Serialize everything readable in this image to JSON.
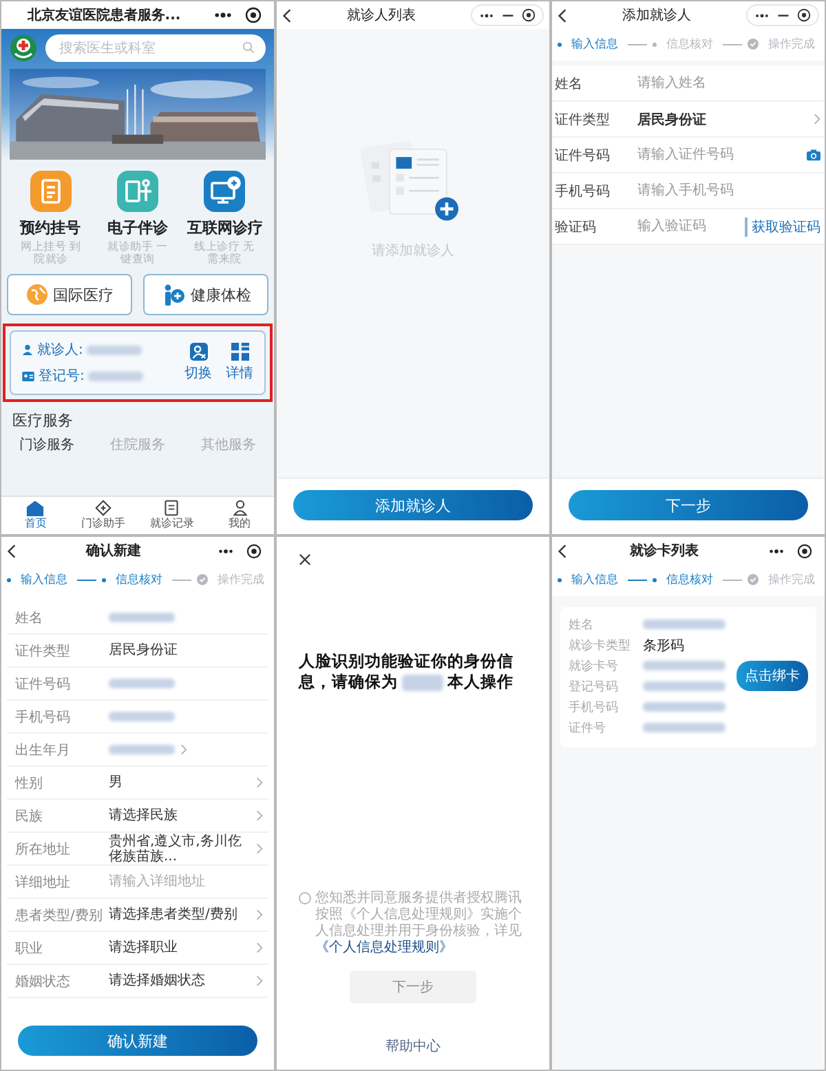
{
  "home": {
    "title": "北京友谊医院患者服务...",
    "search": {
      "placeholder": "搜索医生或科室"
    },
    "services": [
      {
        "kind": "register",
        "title": "预约挂号",
        "subtitle": "网上挂号 到院就诊",
        "color": "#f59a2c"
      },
      {
        "kind": "guide",
        "title": "电子伴诊",
        "subtitle": "就诊助手 一键查询",
        "color": "#3bb5b0"
      },
      {
        "kind": "online",
        "title": "互联网诊疗",
        "subtitle": "线上诊疗 无需来院",
        "color": "#1b7fc4"
      }
    ],
    "features": [
      {
        "kind": "globe",
        "label": "国际医疗"
      },
      {
        "kind": "checkup",
        "label": "健康体检"
      }
    ],
    "patient_card": {
      "fields": [
        {
          "kind": "user",
          "label": "就诊人:",
          "redacted": true
        },
        {
          "kind": "id",
          "label": "登记号:",
          "redacted": true
        }
      ],
      "actions": [
        {
          "kind": "switch",
          "label": "切换"
        },
        {
          "kind": "details",
          "label": "详情"
        }
      ]
    },
    "section_title": "医疗服务",
    "tabs": [
      {
        "label": "门诊服务",
        "selected": true
      },
      {
        "label": "住院服务",
        "selected": false
      },
      {
        "label": "其他服务",
        "selected": false
      }
    ],
    "tabbar": [
      {
        "kind": "home",
        "label": "首页",
        "selected": true
      },
      {
        "kind": "clinic",
        "label": "门诊助手",
        "selected": false
      },
      {
        "kind": "records",
        "label": "就诊记录",
        "selected": false
      },
      {
        "kind": "profile",
        "label": "我的",
        "selected": false
      }
    ]
  },
  "patient_list": {
    "title": "就诊人列表",
    "empty_text": "请添加就诊人",
    "button": "添加就诊人"
  },
  "add_patient": {
    "title": "添加就诊人",
    "steps": [
      {
        "kind": "dot",
        "label": "输入信息",
        "active": true
      },
      {
        "kind": "dot",
        "label": "信息核对",
        "active": false
      },
      {
        "kind": "check",
        "label": "操作完成",
        "active": false
      }
    ],
    "fields": [
      {
        "label": "姓名",
        "placeholder": "请输入姓名"
      },
      {
        "label": "证件类型",
        "value": "居民身份证",
        "chevron": true
      },
      {
        "label": "证件号码",
        "placeholder": "请输入证件号码",
        "kind": "camera"
      },
      {
        "label": "手机号码",
        "placeholder": "请输入手机号码"
      },
      {
        "label": "验证码",
        "placeholder": "输入验证码",
        "action": "获取验证码"
      }
    ],
    "button": "下一步"
  },
  "confirm_new": {
    "title": "确认新建",
    "steps": [
      {
        "kind": "dot",
        "label": "输入信息",
        "active": true
      },
      {
        "kind": "dot",
        "label": "信息核对",
        "active": true
      },
      {
        "kind": "check",
        "label": "操作完成",
        "active": false
      }
    ],
    "fields": [
      {
        "label": "姓名",
        "redacted": true
      },
      {
        "label": "证件类型",
        "value": "居民身份证"
      },
      {
        "label": "证件号码",
        "redacted": true
      },
      {
        "label": "手机号码",
        "redacted": true
      },
      {
        "label": "出生年月",
        "redacted": true,
        "chevron": true
      },
      {
        "label": "性别",
        "value": "男",
        "chevron": true
      },
      {
        "label": "民族",
        "value": "请选择民族",
        "chevron": true
      },
      {
        "label": "所在地址",
        "value": "贵州省,遵义市,务川仡佬族苗族...",
        "chevron": true
      },
      {
        "label": "详细地址",
        "placeholder": "请输入详细地址"
      },
      {
        "label": "患者类型/费别",
        "value": "请选择患者类型/费别",
        "chevron": true
      },
      {
        "label": "职业",
        "value": "请选择职业",
        "chevron": true
      },
      {
        "label": "婚姻状态",
        "value": "请选择婚姻状态",
        "chevron": true
      }
    ],
    "button": "确认新建"
  },
  "face_verify": {
    "heading_before": "人脸识别功能验证你的身份信息，请确保为",
    "heading_after": "本人操作",
    "consent": {
      "checked": false,
      "text": "您知悉并同意服务提供者授权腾讯按照《个人信息处理规则》实施个人信息处理并用于身份核验，详见",
      "link": "《个人信息处理规则》"
    },
    "button": {
      "label": "下一步",
      "disabled": true
    },
    "help": "帮助中心"
  },
  "card_list": {
    "title": "就诊卡列表",
    "steps": [
      {
        "kind": "dot",
        "label": "输入信息",
        "active": true
      },
      {
        "kind": "dot",
        "label": "信息核对",
        "active": true
      },
      {
        "kind": "check",
        "label": "操作完成",
        "active": false
      }
    ],
    "fields": [
      {
        "label": "姓名",
        "redacted": true
      },
      {
        "label": "就诊卡类型",
        "value": "条形码"
      },
      {
        "label": "就诊卡号",
        "redacted": true
      },
      {
        "label": "登记号码",
        "redacted": true
      },
      {
        "label": "手机号码",
        "redacted": true
      },
      {
        "label": "证件号",
        "redacted": true
      }
    ],
    "button": "点击绑卡"
  }
}
